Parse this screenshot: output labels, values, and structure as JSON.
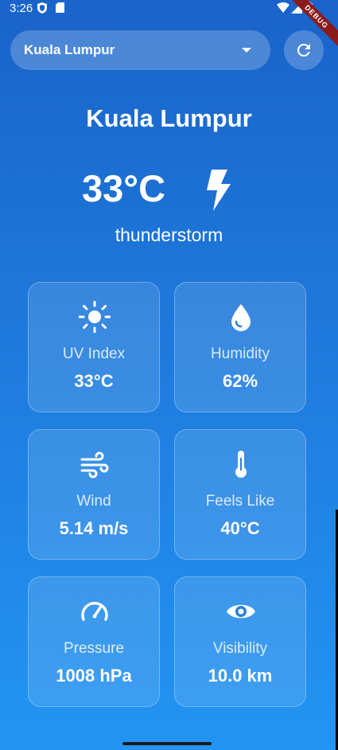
{
  "status_bar": {
    "time": "3:26",
    "icons": [
      "shield-icon",
      "sd-card-icon",
      "wifi-icon",
      "cell-signal-icon",
      "battery-icon"
    ]
  },
  "debug_banner": "DEBUG",
  "city_selector": {
    "selected": "Kuala Lumpur",
    "caret_icon": "chevron-down-icon"
  },
  "refresh_button": {
    "icon": "refresh-icon"
  },
  "current": {
    "city": "Kuala Lumpur",
    "temperature": "33°C",
    "condition": "thunderstorm",
    "condition_icon": "lightning-icon"
  },
  "metrics": [
    {
      "label": "UV Index",
      "value": "33°C",
      "icon": "sun-icon"
    },
    {
      "label": "Humidity",
      "value": "62%",
      "icon": "water-drop-icon"
    },
    {
      "label": "Wind",
      "value": "5.14 m/s",
      "icon": "wind-icon"
    },
    {
      "label": "Feels Like",
      "value": "40°C",
      "icon": "thermometer-icon"
    },
    {
      "label": "Pressure",
      "value": "1008 hPa",
      "icon": "speedometer-icon"
    },
    {
      "label": "Visibility",
      "value": "10.0 km",
      "icon": "eye-icon"
    }
  ],
  "colors": {
    "background_top": "#1a63c9",
    "background_bottom": "#2394f2",
    "debug_ribbon": "#8b1a1a"
  }
}
